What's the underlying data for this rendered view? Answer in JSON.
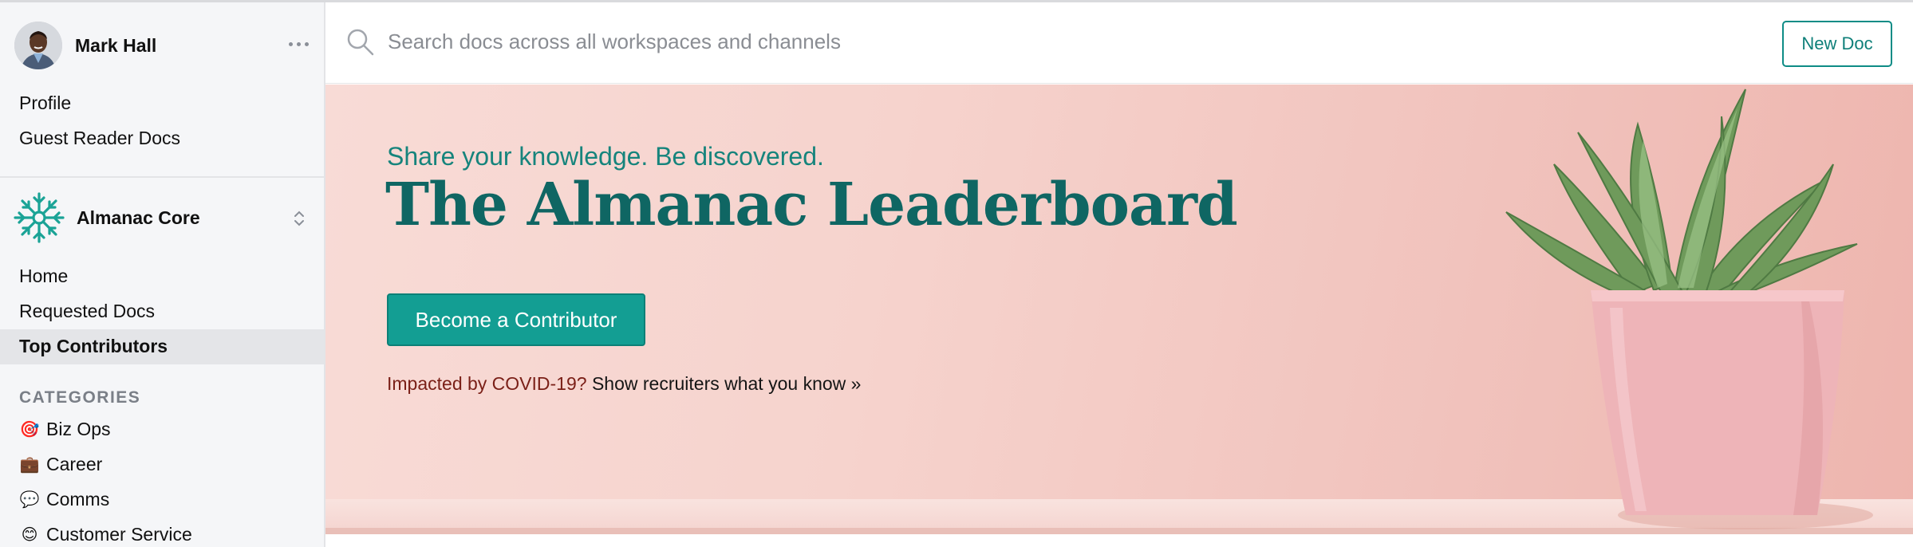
{
  "user": {
    "name": "Mark Hall"
  },
  "sidebar": {
    "top_links": [
      {
        "label": "Profile"
      },
      {
        "label": "Guest Reader Docs"
      }
    ],
    "workspace": {
      "name": "Almanac Core"
    },
    "nav": [
      {
        "label": "Home"
      },
      {
        "label": "Requested Docs"
      },
      {
        "label": "Top Contributors",
        "active": true
      }
    ],
    "categories_heading": "CATEGORIES",
    "categories": [
      {
        "emoji": "🎯",
        "label": "Biz Ops"
      },
      {
        "emoji": "💼",
        "label": "Career"
      },
      {
        "emoji": "💬",
        "label": "Comms"
      },
      {
        "emoji": "😊",
        "label": "Customer Service"
      }
    ]
  },
  "header": {
    "search_placeholder": "Search docs across all workspaces and channels",
    "new_doc_label": "New Doc"
  },
  "hero": {
    "subtitle": "Share your knowledge. Be discovered.",
    "title": "The Almanac Leaderboard",
    "cta_label": "Become a Contributor",
    "note_prefix": "Impacted by COVID-19?",
    "note_link": "Show recruiters what you know »"
  },
  "colors": {
    "accent": "#139e93",
    "title_teal": "#0f6663",
    "sidebar_bg": "#f5f6f8",
    "hero_pink": "#f6d3cd",
    "covid_red": "#7a1f17"
  },
  "icons": [
    "more-horizontal-icon",
    "snowflake-logo-icon",
    "chevron-up-down-icon",
    "search-icon"
  ]
}
